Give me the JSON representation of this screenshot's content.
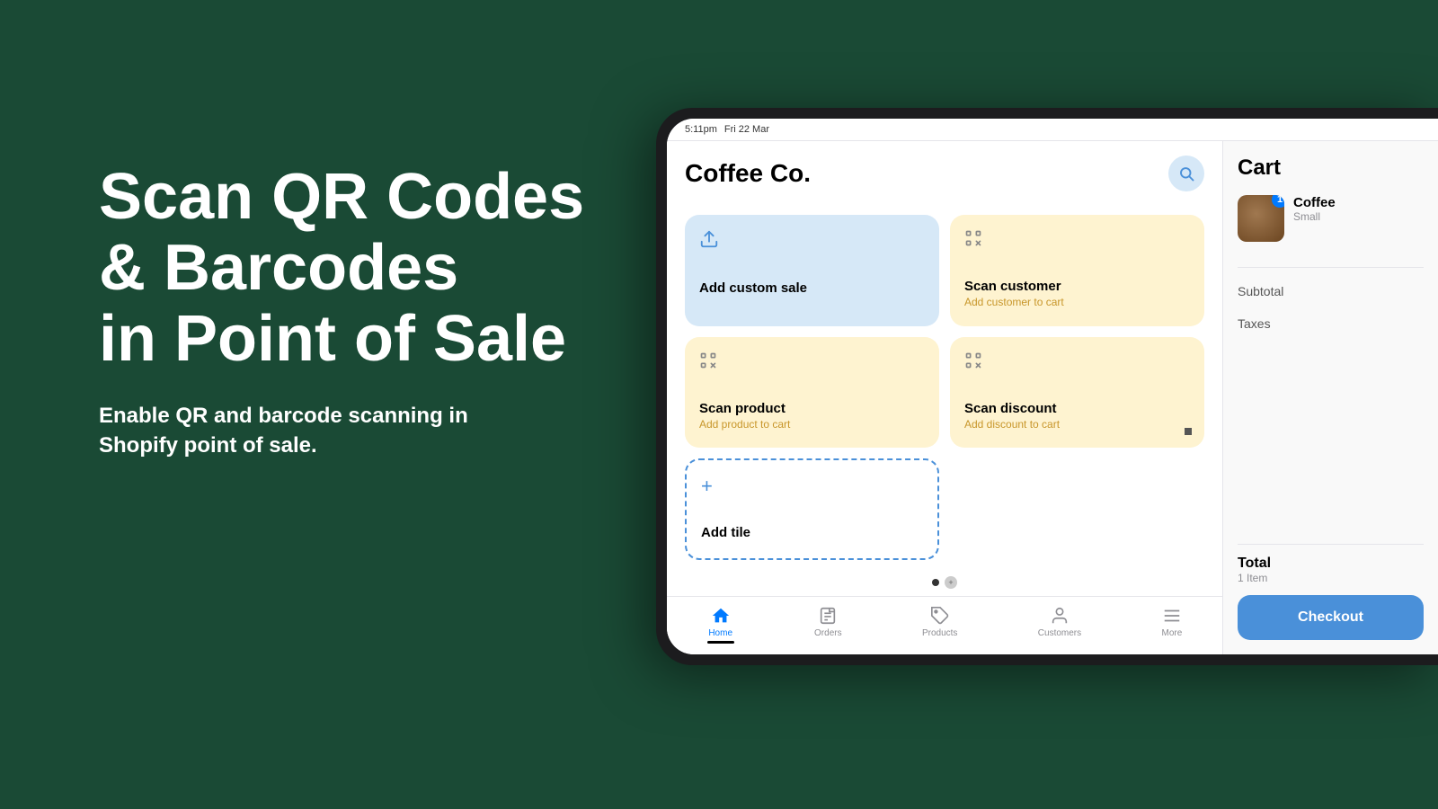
{
  "background": {
    "color": "#1a4a35"
  },
  "left_panel": {
    "heading_line1": "Scan QR Codes",
    "heading_line2": "& Barcodes",
    "heading_line3": "in Point of Sale",
    "subheading_line1": "Enable QR and barcode scanning in",
    "subheading_line2": "Shopify point of sale."
  },
  "device": {
    "status_bar": {
      "time": "5:11pm",
      "date": "Fri 22 Mar"
    },
    "pos": {
      "title": "Coffee Co.",
      "tiles": [
        {
          "id": "add-custom-sale",
          "label": "Add custom sale",
          "sublabel": "",
          "type": "blue",
          "icon": "upload"
        },
        {
          "id": "scan-customer",
          "label": "Scan customer",
          "sublabel": "Add customer to cart",
          "type": "yellow",
          "icon": "scan"
        },
        {
          "id": "scan-product",
          "label": "Scan product",
          "sublabel": "Add product to cart",
          "type": "yellow",
          "icon": "scan"
        },
        {
          "id": "scan-discount",
          "label": "Scan discount",
          "sublabel": "Add discount to cart",
          "type": "yellow",
          "icon": "scan"
        }
      ],
      "add_tile_label": "Add tile",
      "nav": [
        {
          "id": "home",
          "label": "Home",
          "active": true
        },
        {
          "id": "orders",
          "label": "Orders",
          "active": false
        },
        {
          "id": "products",
          "label": "Products",
          "active": false
        },
        {
          "id": "customers",
          "label": "Customers",
          "active": false
        },
        {
          "id": "more",
          "label": "More",
          "active": false
        }
      ]
    },
    "cart": {
      "title": "Cart",
      "item": {
        "name": "Coffee",
        "variant": "Small",
        "quantity": 1
      },
      "subtotal_label": "Subtotal",
      "taxes_label": "Taxes",
      "total_label": "Total",
      "total_items": "1 Item",
      "checkout_label": "Checkout"
    }
  }
}
